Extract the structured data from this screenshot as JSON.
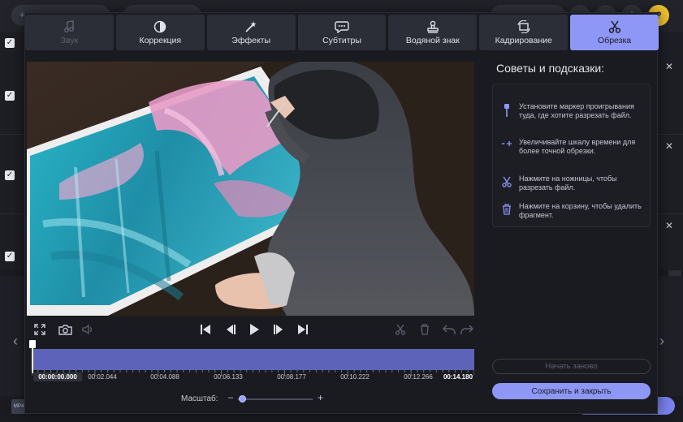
{
  "tabs": [
    {
      "label": "Звук",
      "icon": "music-note-icon",
      "state": "disabled"
    },
    {
      "label": "Коррекция",
      "icon": "contrast-icon",
      "state": "normal"
    },
    {
      "label": "Эффекты",
      "icon": "magic-wand-icon",
      "state": "normal"
    },
    {
      "label": "Субтитры",
      "icon": "speech-bubble-icon",
      "state": "normal"
    },
    {
      "label": "Водяной знак",
      "icon": "stamp-icon",
      "state": "normal"
    },
    {
      "label": "Кадрирование",
      "icon": "crop-rotate-icon",
      "state": "normal"
    },
    {
      "label": "Обрезка",
      "icon": "scissors-icon",
      "state": "active"
    }
  ],
  "tips": {
    "title": "Советы и подсказки:",
    "items": [
      {
        "icon": "marker-pin-icon",
        "text": "Установите маркер проигрывания туда, где хотите разрезать файл."
      },
      {
        "icon": "zoom-timeline-icon",
        "text": "Увеличивайте шкалу времени для более точной обрезки."
      },
      {
        "icon": "scissors-icon",
        "text": "Нажмите на ножницы, чтобы разрезать файл."
      },
      {
        "icon": "trash-icon",
        "text": "Нажмите на корзину, чтобы удалить фрагмент."
      }
    ]
  },
  "timeline": {
    "current_time": "00:00:00.000",
    "end_time": "00:14.180",
    "ticks": [
      "00:02.044",
      "00:04.088",
      "00:06.133",
      "00:08.177",
      "00:10.222",
      "00:12.266"
    ],
    "marker_fraction": 0.0
  },
  "scale": {
    "label": "Масштаб:",
    "minus": "–",
    "plus": "+",
    "value_fraction": 0.0
  },
  "buttons": {
    "reset": "Начать заново",
    "save": "Сохранить и закрыть"
  },
  "colors": {
    "accent": "#8e96f6",
    "track": "#5c63b8",
    "background": "#1a1b20"
  }
}
